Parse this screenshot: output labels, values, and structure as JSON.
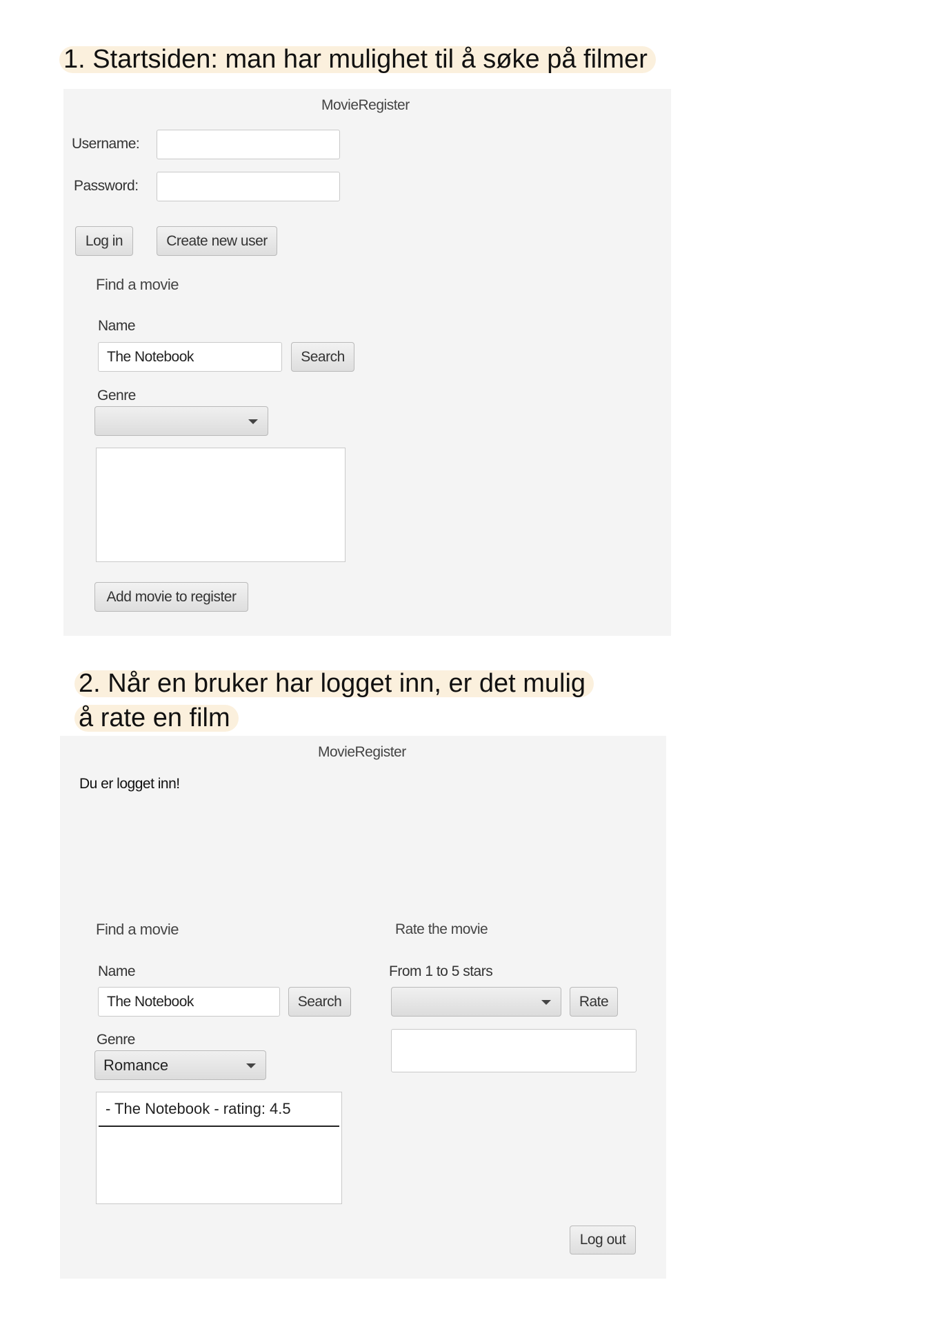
{
  "section1": {
    "heading": "1. Startsiden: man har mulighet til å søke på filmer",
    "app_title": "MovieRegister",
    "username_label": "Username:",
    "username_value": "",
    "password_label": "Password:",
    "password_value": "",
    "login_button": "Log in",
    "create_user_button": "Create new user",
    "find_title": "Find a movie",
    "name_label": "Name",
    "name_value": "The Notebook",
    "search_button": "Search",
    "genre_label": "Genre",
    "genre_value": "",
    "results": [],
    "add_movie_button": "Add movie to register"
  },
  "section2": {
    "heading_line1": "2. Når en bruker har logget inn, er det mulig",
    "heading_line2": "å rate en film",
    "app_title": "MovieRegister",
    "status_message": "Du er logget inn!",
    "find_title": "Find a movie",
    "name_label": "Name",
    "name_value": "The Notebook",
    "search_button": "Search",
    "genre_label": "Genre",
    "genre_value": "Romance",
    "results": [
      "- The Notebook - rating: 4.5"
    ],
    "rate_title": "Rate the movie",
    "stars_label": "From 1 to 5 stars",
    "stars_value": "",
    "rate_button": "Rate",
    "rate_output": "",
    "logout_button": "Log out"
  }
}
